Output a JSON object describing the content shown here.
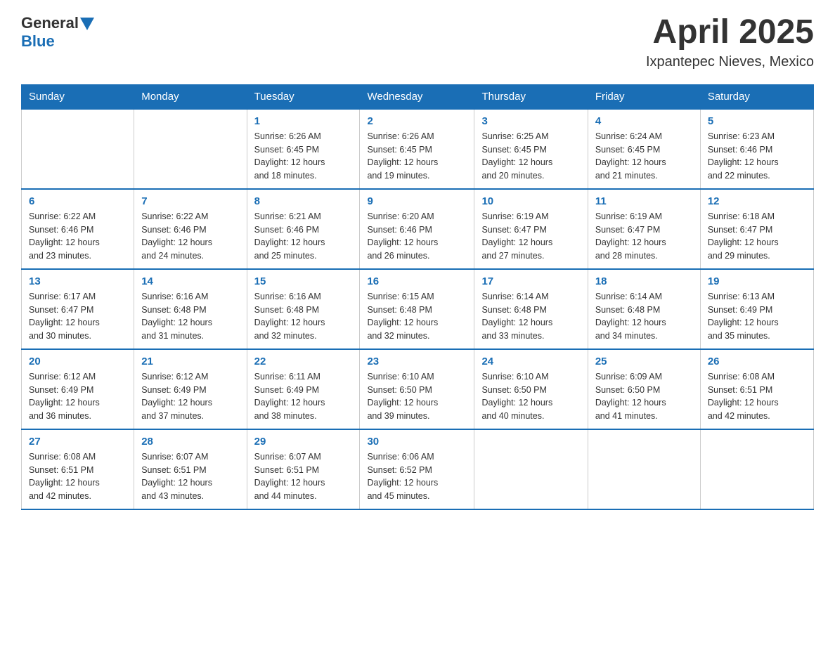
{
  "logo": {
    "general": "General",
    "blue": "Blue"
  },
  "header": {
    "month": "April 2025",
    "location": "Ixpantepec Nieves, Mexico"
  },
  "days_of_week": [
    "Sunday",
    "Monday",
    "Tuesday",
    "Wednesday",
    "Thursday",
    "Friday",
    "Saturday"
  ],
  "weeks": [
    [
      {
        "day": "",
        "info": ""
      },
      {
        "day": "",
        "info": ""
      },
      {
        "day": "1",
        "info": "Sunrise: 6:26 AM\nSunset: 6:45 PM\nDaylight: 12 hours\nand 18 minutes."
      },
      {
        "day": "2",
        "info": "Sunrise: 6:26 AM\nSunset: 6:45 PM\nDaylight: 12 hours\nand 19 minutes."
      },
      {
        "day": "3",
        "info": "Sunrise: 6:25 AM\nSunset: 6:45 PM\nDaylight: 12 hours\nand 20 minutes."
      },
      {
        "day": "4",
        "info": "Sunrise: 6:24 AM\nSunset: 6:45 PM\nDaylight: 12 hours\nand 21 minutes."
      },
      {
        "day": "5",
        "info": "Sunrise: 6:23 AM\nSunset: 6:46 PM\nDaylight: 12 hours\nand 22 minutes."
      }
    ],
    [
      {
        "day": "6",
        "info": "Sunrise: 6:22 AM\nSunset: 6:46 PM\nDaylight: 12 hours\nand 23 minutes."
      },
      {
        "day": "7",
        "info": "Sunrise: 6:22 AM\nSunset: 6:46 PM\nDaylight: 12 hours\nand 24 minutes."
      },
      {
        "day": "8",
        "info": "Sunrise: 6:21 AM\nSunset: 6:46 PM\nDaylight: 12 hours\nand 25 minutes."
      },
      {
        "day": "9",
        "info": "Sunrise: 6:20 AM\nSunset: 6:46 PM\nDaylight: 12 hours\nand 26 minutes."
      },
      {
        "day": "10",
        "info": "Sunrise: 6:19 AM\nSunset: 6:47 PM\nDaylight: 12 hours\nand 27 minutes."
      },
      {
        "day": "11",
        "info": "Sunrise: 6:19 AM\nSunset: 6:47 PM\nDaylight: 12 hours\nand 28 minutes."
      },
      {
        "day": "12",
        "info": "Sunrise: 6:18 AM\nSunset: 6:47 PM\nDaylight: 12 hours\nand 29 minutes."
      }
    ],
    [
      {
        "day": "13",
        "info": "Sunrise: 6:17 AM\nSunset: 6:47 PM\nDaylight: 12 hours\nand 30 minutes."
      },
      {
        "day": "14",
        "info": "Sunrise: 6:16 AM\nSunset: 6:48 PM\nDaylight: 12 hours\nand 31 minutes."
      },
      {
        "day": "15",
        "info": "Sunrise: 6:16 AM\nSunset: 6:48 PM\nDaylight: 12 hours\nand 32 minutes."
      },
      {
        "day": "16",
        "info": "Sunrise: 6:15 AM\nSunset: 6:48 PM\nDaylight: 12 hours\nand 32 minutes."
      },
      {
        "day": "17",
        "info": "Sunrise: 6:14 AM\nSunset: 6:48 PM\nDaylight: 12 hours\nand 33 minutes."
      },
      {
        "day": "18",
        "info": "Sunrise: 6:14 AM\nSunset: 6:48 PM\nDaylight: 12 hours\nand 34 minutes."
      },
      {
        "day": "19",
        "info": "Sunrise: 6:13 AM\nSunset: 6:49 PM\nDaylight: 12 hours\nand 35 minutes."
      }
    ],
    [
      {
        "day": "20",
        "info": "Sunrise: 6:12 AM\nSunset: 6:49 PM\nDaylight: 12 hours\nand 36 minutes."
      },
      {
        "day": "21",
        "info": "Sunrise: 6:12 AM\nSunset: 6:49 PM\nDaylight: 12 hours\nand 37 minutes."
      },
      {
        "day": "22",
        "info": "Sunrise: 6:11 AM\nSunset: 6:49 PM\nDaylight: 12 hours\nand 38 minutes."
      },
      {
        "day": "23",
        "info": "Sunrise: 6:10 AM\nSunset: 6:50 PM\nDaylight: 12 hours\nand 39 minutes."
      },
      {
        "day": "24",
        "info": "Sunrise: 6:10 AM\nSunset: 6:50 PM\nDaylight: 12 hours\nand 40 minutes."
      },
      {
        "day": "25",
        "info": "Sunrise: 6:09 AM\nSunset: 6:50 PM\nDaylight: 12 hours\nand 41 minutes."
      },
      {
        "day": "26",
        "info": "Sunrise: 6:08 AM\nSunset: 6:51 PM\nDaylight: 12 hours\nand 42 minutes."
      }
    ],
    [
      {
        "day": "27",
        "info": "Sunrise: 6:08 AM\nSunset: 6:51 PM\nDaylight: 12 hours\nand 42 minutes."
      },
      {
        "day": "28",
        "info": "Sunrise: 6:07 AM\nSunset: 6:51 PM\nDaylight: 12 hours\nand 43 minutes."
      },
      {
        "day": "29",
        "info": "Sunrise: 6:07 AM\nSunset: 6:51 PM\nDaylight: 12 hours\nand 44 minutes."
      },
      {
        "day": "30",
        "info": "Sunrise: 6:06 AM\nSunset: 6:52 PM\nDaylight: 12 hours\nand 45 minutes."
      },
      {
        "day": "",
        "info": ""
      },
      {
        "day": "",
        "info": ""
      },
      {
        "day": "",
        "info": ""
      }
    ]
  ]
}
